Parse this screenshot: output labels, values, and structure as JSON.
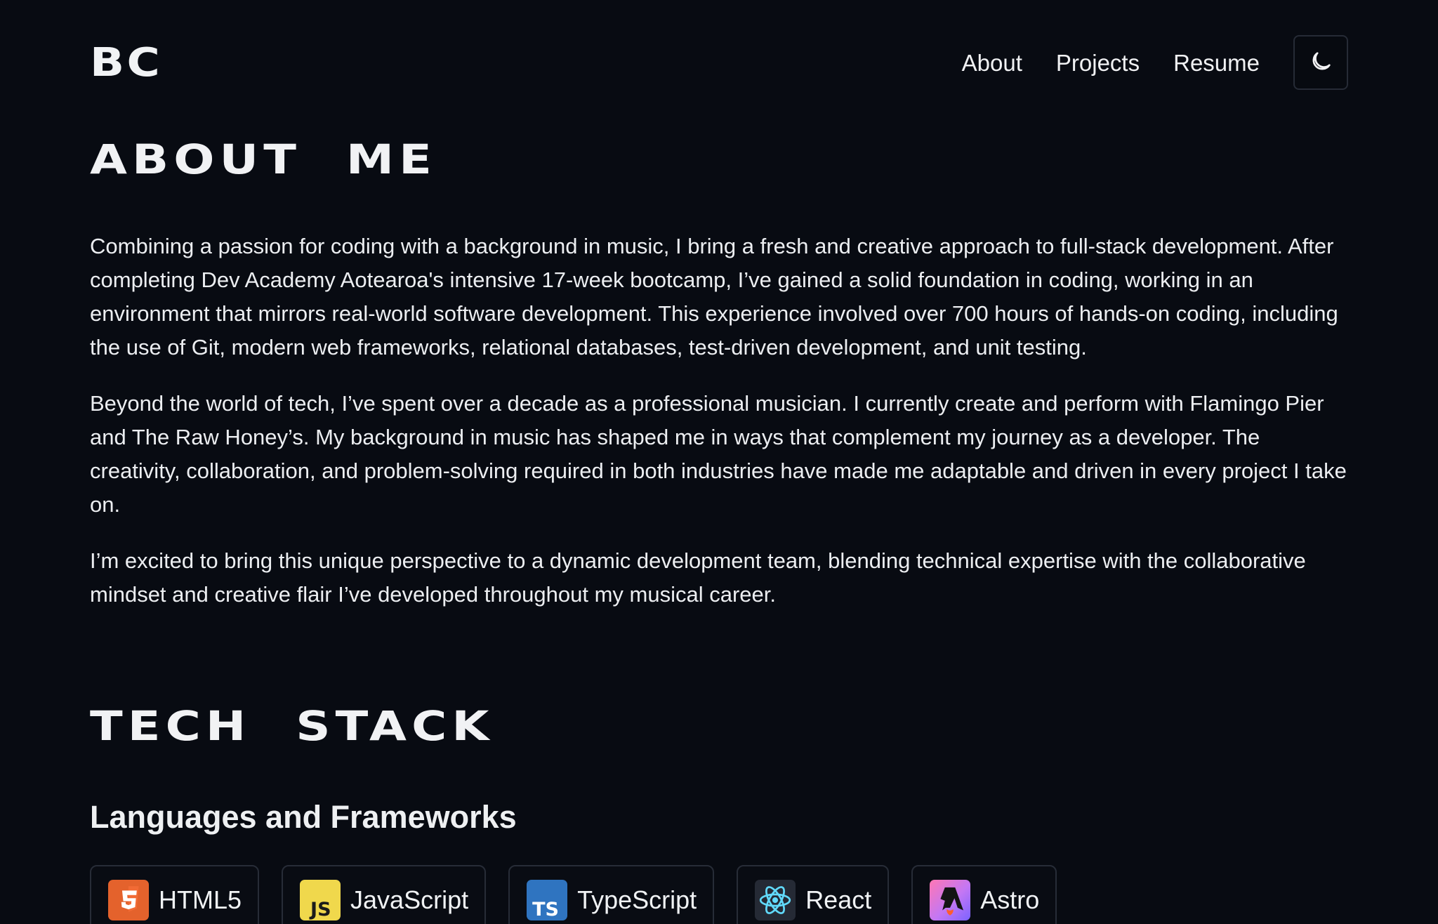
{
  "header": {
    "logo": "BC",
    "nav": [
      {
        "label": "About"
      },
      {
        "label": "Projects"
      },
      {
        "label": "Resume"
      }
    ],
    "theme_toggle_icon": "moon-icon"
  },
  "about": {
    "title": "ABOUT ME",
    "paragraphs": [
      "Combining a passion for coding with a background in music, I bring a fresh and creative approach to full-stack development. After completing Dev Academy Aotearoa's intensive 17-week bootcamp, I’ve gained a solid foundation in coding, working in an environment that mirrors real-world software development. This experience involved over 700 hours of hands-on coding, including the use of Git, modern web frameworks, relational databases, test-driven development, and unit testing.",
      "Beyond the world of tech, I’ve spent over a decade as a professional musician. I currently create and perform with Flamingo Pier and The Raw Honey’s. My background in music has shaped me in ways that complement my journey as a developer. The creativity, collaboration, and problem-solving required in both industries have made me adaptable and driven in every project I take on.",
      "I’m excited to bring this unique perspective to a dynamic development team, blending technical expertise with the collaborative mindset and creative flair I’ve developed throughout my musical career."
    ]
  },
  "tech_stack": {
    "title": "TECH STACK",
    "subheading": "Languages and Frameworks",
    "items": [
      {
        "label": "HTML5",
        "icon": "html5-icon",
        "color": "#e4622c"
      },
      {
        "label": "JavaScript",
        "icon": "javascript-icon",
        "color": "#f0d84c"
      },
      {
        "label": "TypeScript",
        "icon": "typescript-icon",
        "color": "#2f74c0"
      },
      {
        "label": "React",
        "icon": "react-icon",
        "color": "#61dafb"
      },
      {
        "label": "Astro",
        "icon": "astro-icon",
        "color": "#ff77b4"
      }
    ]
  },
  "colors": {
    "background": "#080b12",
    "text": "#e8eaee",
    "border": "#272c37"
  }
}
